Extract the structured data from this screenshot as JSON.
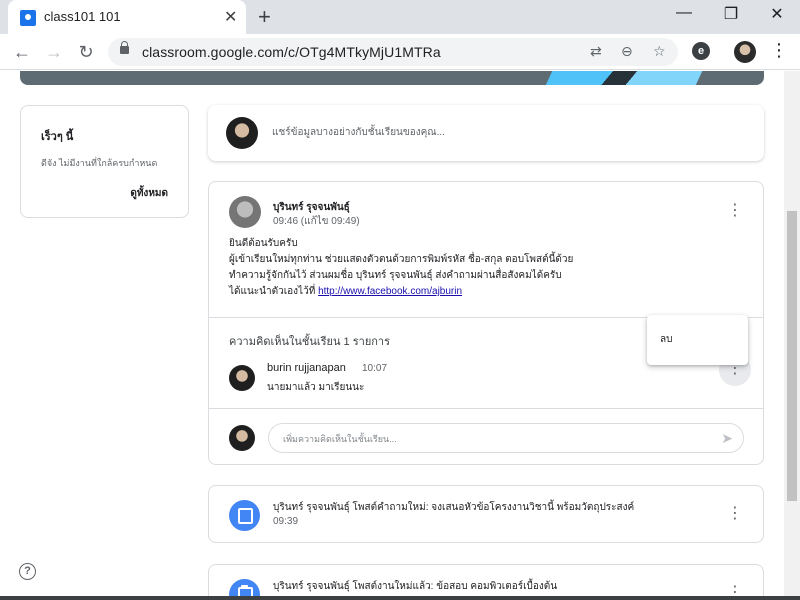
{
  "browser": {
    "tab_title": "class101 101",
    "tab_close": "✕",
    "new_tab": "+",
    "window_controls": {
      "minimize": "—",
      "restore": "❐",
      "close": "✕"
    },
    "nav": {
      "back": "←",
      "forward": "→",
      "reload": "↻"
    },
    "url": "classroom.google.com/c/OTg4MTkyMjU1MTRa",
    "omnibox_icons": {
      "translate": "⇄",
      "zoom": "⊖",
      "bookmark": "☆"
    },
    "extension_label": "e",
    "menu": "⋮"
  },
  "upcoming": {
    "title": "เร็วๆ นี้",
    "text": "ดีจัง ไม่มีงานที่ใกล้ครบกำหนด",
    "view_all": "ดูทั้งหมด"
  },
  "share": {
    "placeholder": "แชร์ข้อมูลบางอย่างกับชั้นเรียนของคุณ..."
  },
  "post": {
    "author": "บุรินทร์ รุจจนพันธุ์",
    "time": "09:46 (แก้ไข 09:49)",
    "menu": "⋮",
    "body_lines": [
      "ยินดีต้อนรับครับ",
      "ผู้เข้าเรียนใหม่ทุกท่าน ช่วยแสดงตัวตนด้วยการพิมพ์รหัส ชื่อ-สกุล ตอบโพสต์นี้ด้วย",
      "ทำความรู้จักกันไว้ ส่วนผมชื่อ บุรินทร์ รุจจนพันธุ์ ส่งคำถามผ่านสื่อสังคมได้ครับ"
    ],
    "link_prefix": "ได้แนะนำตัวเองไว้ที่ ",
    "link": "http://www.facebook.com/ajburin",
    "comments_count": "ความคิดเห็นในชั้นเรียน 1 รายการ",
    "comment": {
      "author": "burin rujjanapan",
      "time": "10:07",
      "text": "นายมาแล้ว มาเรียนนะ",
      "menu": "⋮"
    },
    "comment_input_placeholder": "เพิ่มความคิดเห็นในชั้นเรียน...",
    "send_icon": "➤"
  },
  "context_menu": {
    "delete": "ลบ"
  },
  "stream": [
    {
      "title": "บุรินทร์ รุจจนพันธุ์ โพสต์คำถามใหม่: จงเสนอหัวข้อโครงงานวิชานี้ พร้อมวัตถุประสงค์",
      "time": "09:39",
      "menu": "⋮",
      "icon": "question-icon"
    },
    {
      "title": "บุรินทร์ รุจจนพันธุ์ โพสต์งานใหม่แล้ว: ข้อสอบ คอมพิวเตอร์เบื้องต้น",
      "time": "",
      "menu": "⋮",
      "icon": "assignment-icon"
    }
  ],
  "help": "?"
}
